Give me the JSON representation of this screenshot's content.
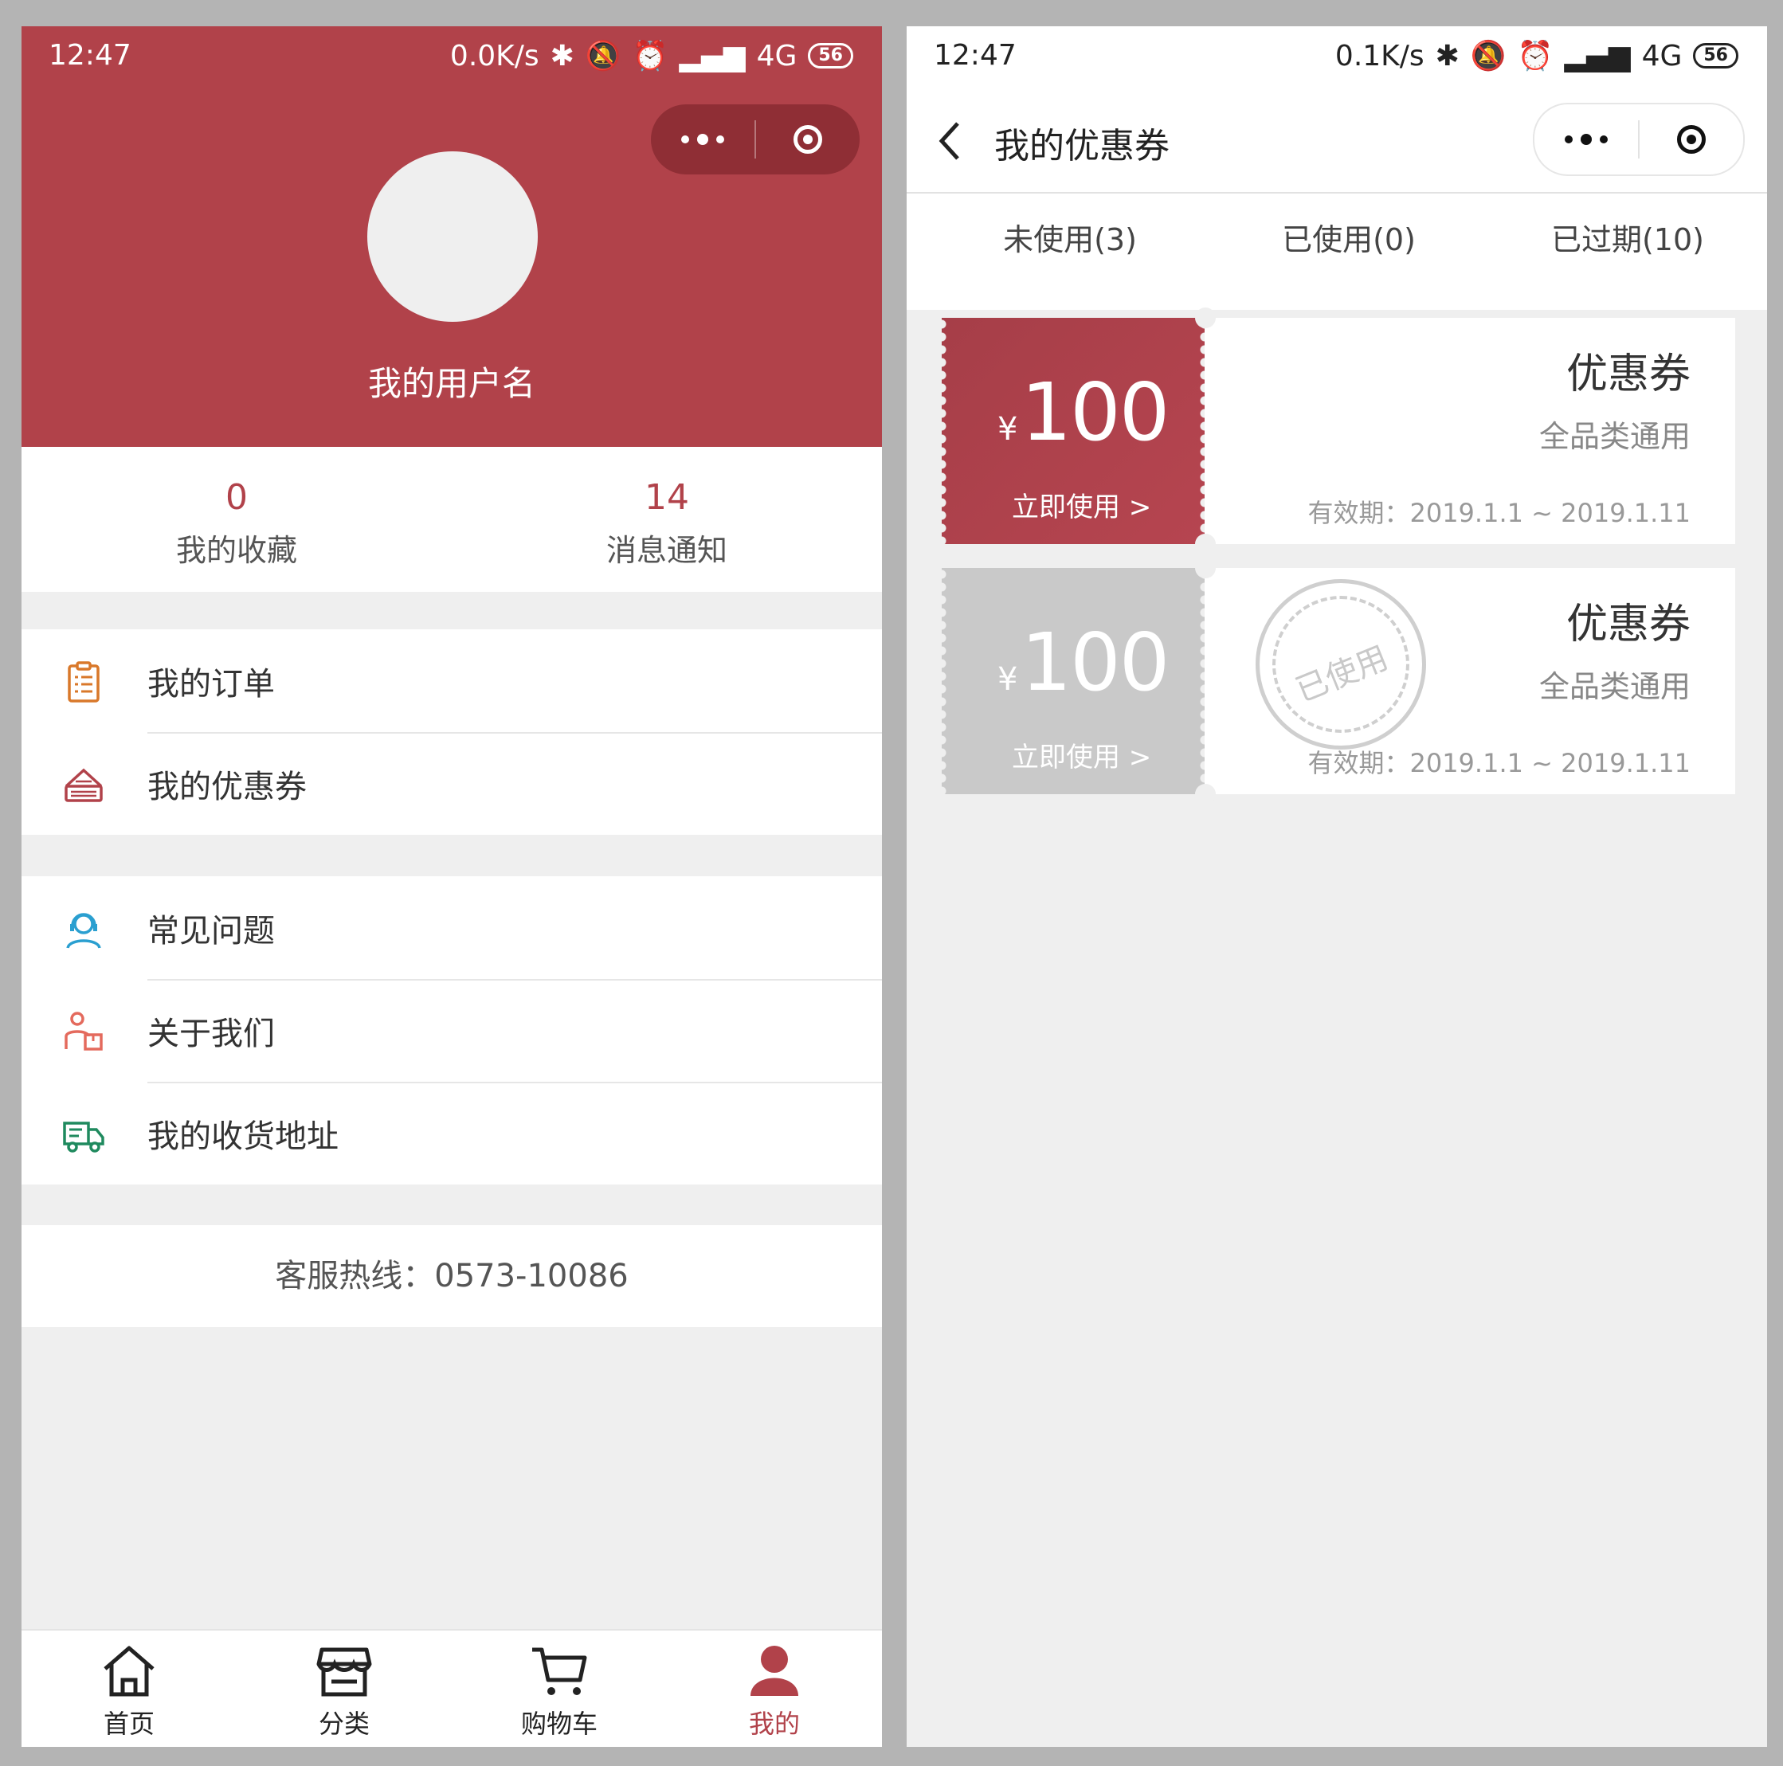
{
  "left": {
    "status": {
      "time": "12:47",
      "speed": "0.0K/s",
      "network": "4G",
      "battery": "56"
    },
    "profile": {
      "username": "我的用户名"
    },
    "stats": [
      {
        "value": "0",
        "label": "我的收藏"
      },
      {
        "value": "14",
        "label": "消息通知"
      }
    ],
    "menu_group1": [
      {
        "label": "我的订单",
        "icon": "clipboard-icon",
        "color": "#d9782a"
      },
      {
        "label": "我的优惠券",
        "icon": "coupon-icon",
        "color": "#b1424a"
      }
    ],
    "menu_group2": [
      {
        "label": "常见问题",
        "icon": "headset-icon",
        "color": "#2a9fd0"
      },
      {
        "label": "关于我们",
        "icon": "delivery-person-icon",
        "color": "#e46a5d"
      },
      {
        "label": "我的收货地址",
        "icon": "truck-icon",
        "color": "#1f8a5e"
      }
    ],
    "hotline": "客服热线：0573-10086",
    "tabbar": [
      {
        "label": "首页",
        "icon": "home-icon"
      },
      {
        "label": "分类",
        "icon": "store-icon"
      },
      {
        "label": "购物车",
        "icon": "cart-icon"
      },
      {
        "label": "我的",
        "icon": "user-icon",
        "active": true
      }
    ],
    "accent": "#b1424a"
  },
  "right": {
    "status": {
      "time": "12:47",
      "speed": "0.1K/s",
      "network": "4G",
      "battery": "56"
    },
    "title": "我的优惠券",
    "tabs": [
      "未使用(3)",
      "已使用(0)",
      "已过期(10)"
    ],
    "coupons": [
      {
        "yen": "¥",
        "amount": "100",
        "use_label": "立即使用 >",
        "title": "优惠券",
        "subtitle": "全品类通用",
        "validity": "有效期：2019.1.1 ~ 2019.1.11",
        "state": "active"
      },
      {
        "yen": "¥",
        "amount": "100",
        "use_label": "立即使用 >",
        "title": "优惠券",
        "subtitle": "全品类通用",
        "validity": "有效期：2019.1.1 ~ 2019.1.11",
        "state": "used",
        "stamp": "已使用"
      }
    ]
  }
}
